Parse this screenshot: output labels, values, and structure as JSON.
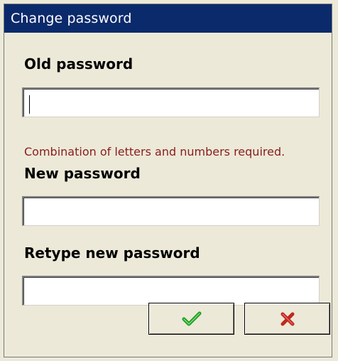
{
  "window": {
    "title": "Change password"
  },
  "old_password": {
    "label": "Old password",
    "value": ""
  },
  "hint": {
    "text": "Combination of letters and numbers required."
  },
  "new_password": {
    "label": "New password",
    "value": ""
  },
  "retype_password": {
    "label": "Retype new password",
    "value": ""
  },
  "buttons": {
    "ok": {
      "icon": "checkmark-icon",
      "color": "#1f9a1f"
    },
    "cancel": {
      "icon": "x-icon",
      "color": "#c0281f"
    }
  }
}
